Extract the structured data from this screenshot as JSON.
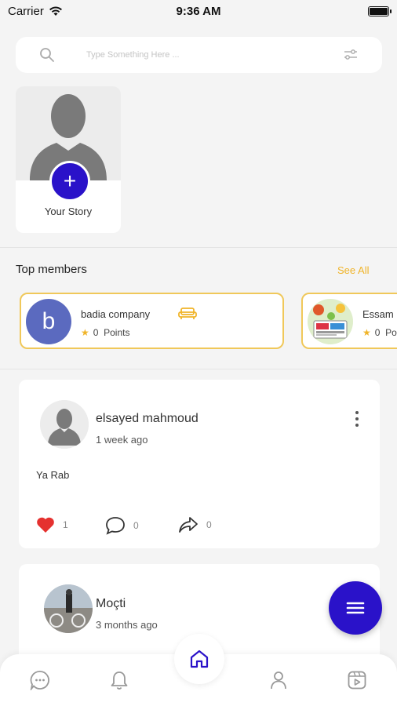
{
  "status_bar": {
    "carrier": "Carrier",
    "time": "9:36 AM"
  },
  "search": {
    "placeholder": "Type Something Here ..."
  },
  "story": {
    "label": "Your Story",
    "add_symbol": "+"
  },
  "top_members": {
    "title": "Top members",
    "see_all": "See All",
    "members": [
      {
        "avatar_letter": "b",
        "name": "badia company",
        "points": "0",
        "points_label": "Points",
        "avatar_color": "#5b6abf"
      },
      {
        "name": "Essam",
        "points": "0",
        "points_label": "Po"
      }
    ]
  },
  "posts": [
    {
      "author": "elsayed mahmoud",
      "time": "1 week ago",
      "text": "Ya Rab",
      "likes": "1",
      "comments": "0",
      "shares": "0"
    },
    {
      "author": "Moçti",
      "time": "3 months ago"
    }
  ],
  "colors": {
    "accent": "#2a12c9",
    "gold": "#f0b429",
    "like": "#e5312f"
  },
  "icons": {
    "search": "search-icon",
    "filter": "filter-icon",
    "plus": "plus-icon",
    "star": "star-icon",
    "sofa": "sofa-icon",
    "more": "more-vertical-icon",
    "heart": "heart-icon",
    "comment": "comment-icon",
    "share": "share-icon",
    "menu": "menu-icon",
    "chat": "chat-icon",
    "bell": "bell-icon",
    "home": "home-icon",
    "profile": "profile-icon",
    "video": "video-icon"
  }
}
